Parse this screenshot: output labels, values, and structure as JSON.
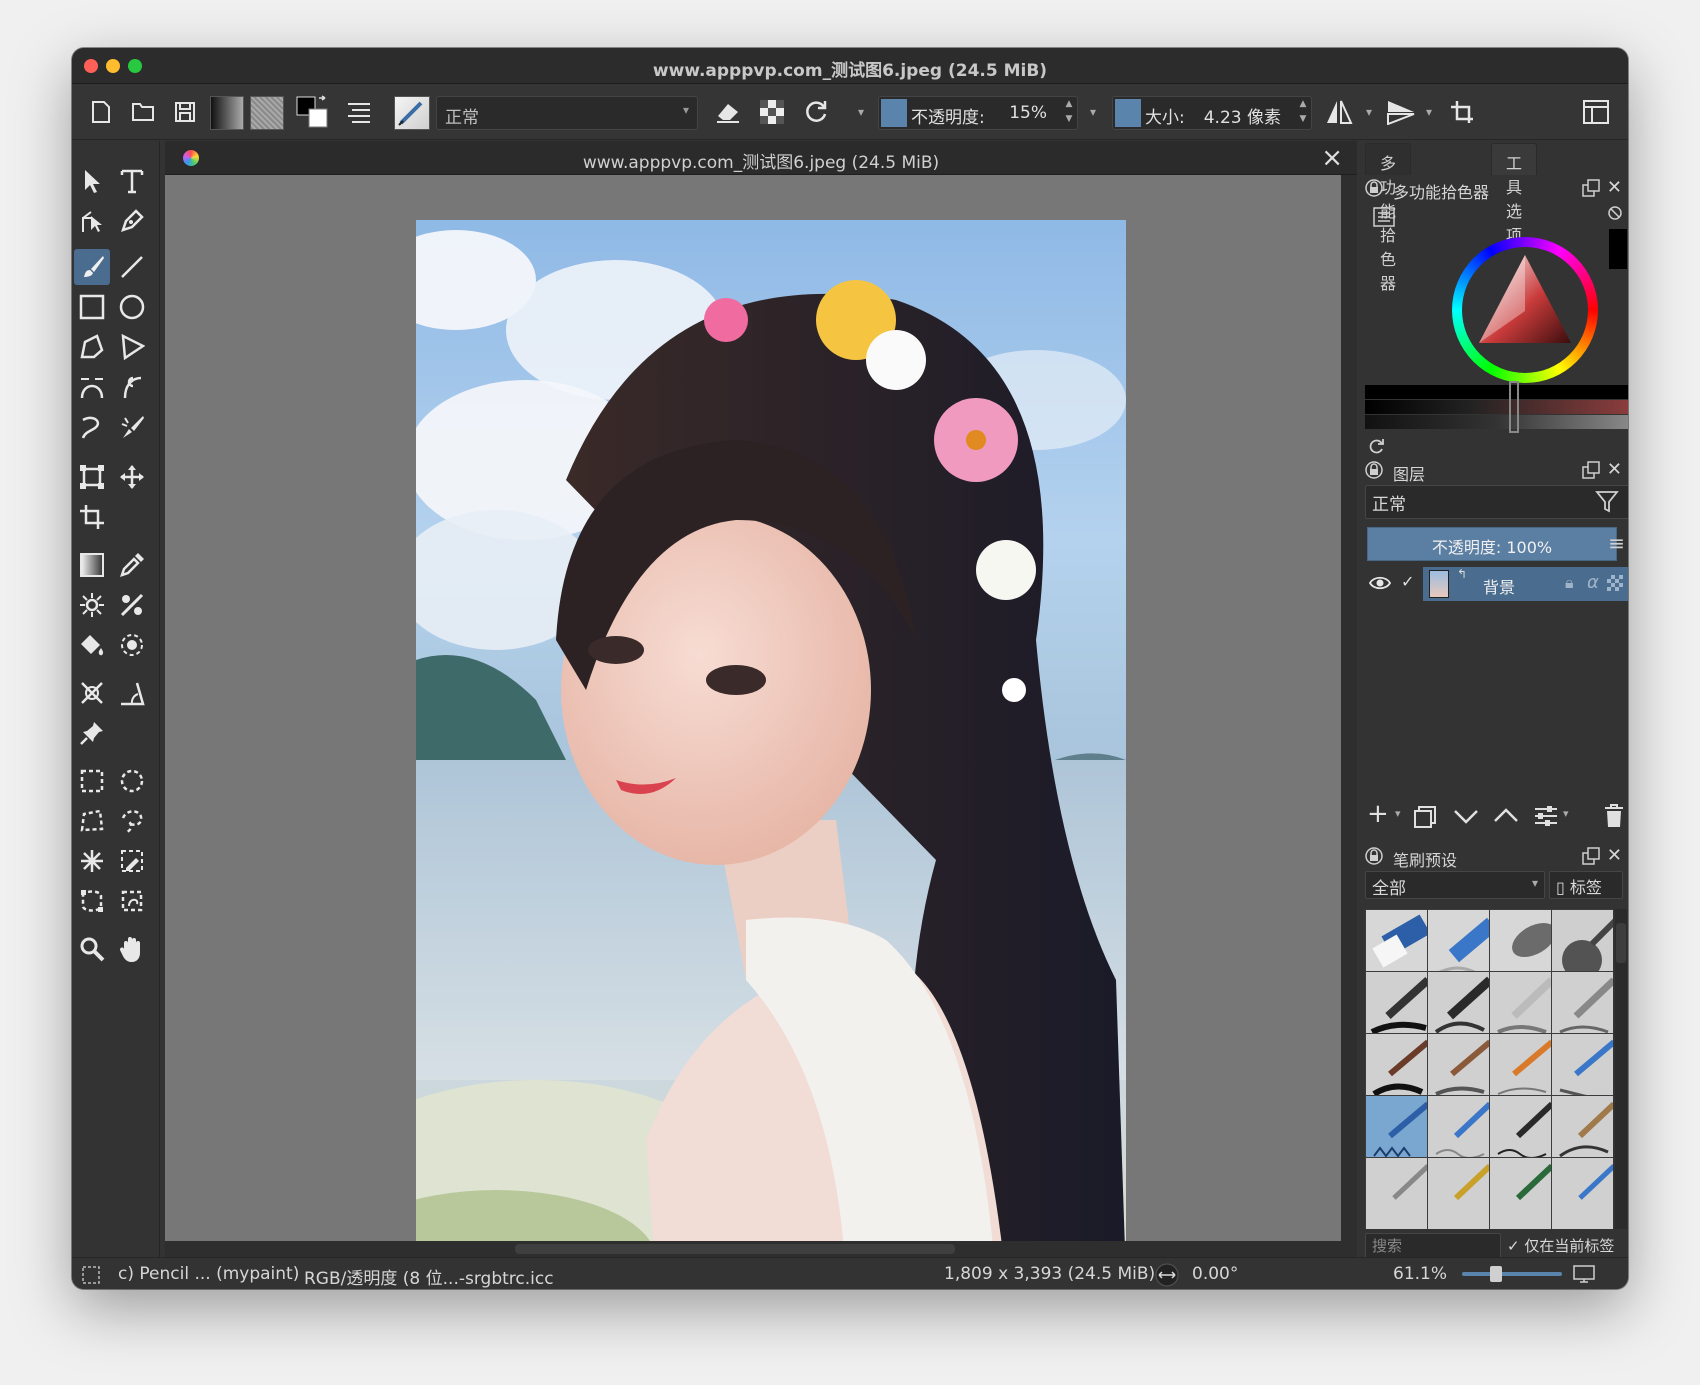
{
  "window": {
    "title": "www.apppvp.com_测试图6.jpeg (24.5 MiB)"
  },
  "toolbar": {
    "blend_mode": "正常",
    "opacity": {
      "label": "不透明度:",
      "value": "15%"
    },
    "size": {
      "label": "大小:",
      "value": "4.23 像素"
    }
  },
  "document": {
    "tab_title": "www.apppvp.com_测试图6.jpeg (24.5 MiB)"
  },
  "dock": {
    "tabs": [
      "多功能拾色器",
      "工具选项"
    ],
    "color_panel": {
      "title": "多功能拾色器"
    },
    "layers_panel": {
      "title": "图层",
      "blend_mode": "正常",
      "opacity_label": "不透明度:  100%",
      "layers": [
        {
          "name": "背景",
          "visible": true
        }
      ]
    },
    "brush_panel": {
      "title": "笔刷预设",
      "filter": "全部",
      "tag_label": "标签",
      "search_placeholder": "搜索",
      "search_in_tag": "仅在当前标签内搜索"
    }
  },
  "status": {
    "brush": "c) Pencil ... (mypaint)",
    "color_space": "RGB/透明度 (8 位...-srgbtrc.icc",
    "image_size": "1,809 x 3,393 (24.5 MiB)",
    "rotation": "0.00°",
    "zoom": "61.1%"
  },
  "colors": {
    "accent": "#4a6d8f",
    "canvas_bg": "#777777",
    "panel_bg": "#333333"
  }
}
